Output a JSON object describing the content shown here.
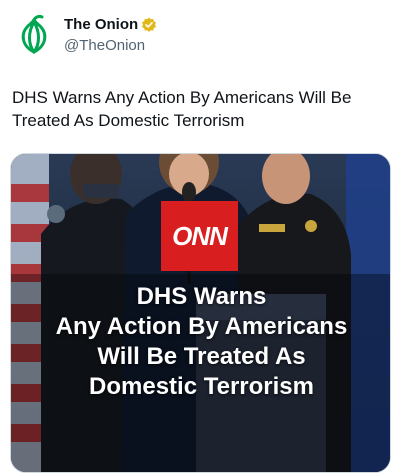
{
  "account": {
    "display_name": "The Onion",
    "handle": "@TheOnion",
    "avatar_icon": "onion-logo-icon",
    "verified_icon": "gold-verified-badge-icon"
  },
  "tweet": {
    "text": "DHS Warns Any Action By Americans Will Be Treated As Domestic Terrorism"
  },
  "media": {
    "logo_text": "ONN",
    "headline_lines": [
      "DHS Warns",
      "Any Action By Americans",
      "Will Be Treated As",
      "Domestic Terrorism"
    ],
    "colors": {
      "logo_red": "#d81e1e",
      "onion_green": "#00a651",
      "badge_gold": "#e2b719"
    }
  }
}
